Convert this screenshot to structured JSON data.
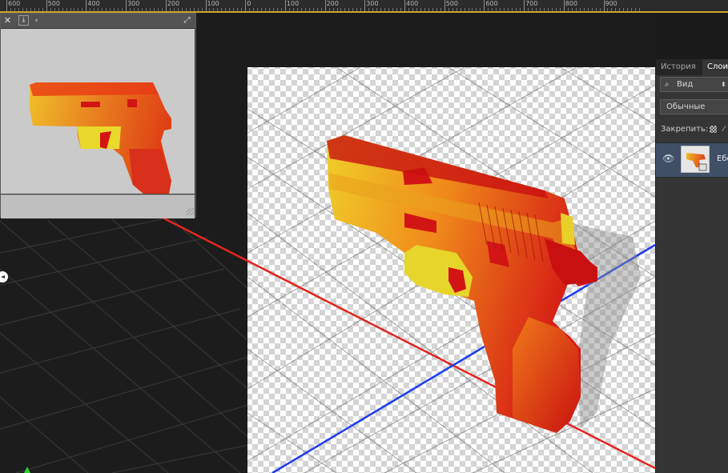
{
  "ruler": {
    "labels": [
      "600",
      "500",
      "400",
      "300",
      "200",
      "100",
      "0",
      "100",
      "200",
      "300",
      "400",
      "500",
      "600",
      "700",
      "800",
      "900"
    ]
  },
  "preview": {
    "close_glyph": "✕",
    "menu_glyph": "⤓",
    "expand_glyph": "⤢"
  },
  "layers_panel": {
    "tabs": [
      "История",
      "Слои"
    ],
    "active_tab": "Слои",
    "filter": {
      "label": "Вид"
    },
    "blend_mode": "Обычные",
    "lock_label": "Закрепить:",
    "layer": {
      "name": "Ебе"
    }
  },
  "scene": {
    "x_axis_color": "#e3241f",
    "z_axis_color": "#1c3cf0",
    "ground_color": "#1c1c1c",
    "gun_highlight": "#f0d02a",
    "gun_mid": "#f08a1a",
    "gun_dark": "#d31414"
  },
  "icons": [
    "eye-icon",
    "search-icon",
    "lock-pixels-icon",
    "close-icon",
    "resize-grip-icon",
    "compass-icon"
  ]
}
